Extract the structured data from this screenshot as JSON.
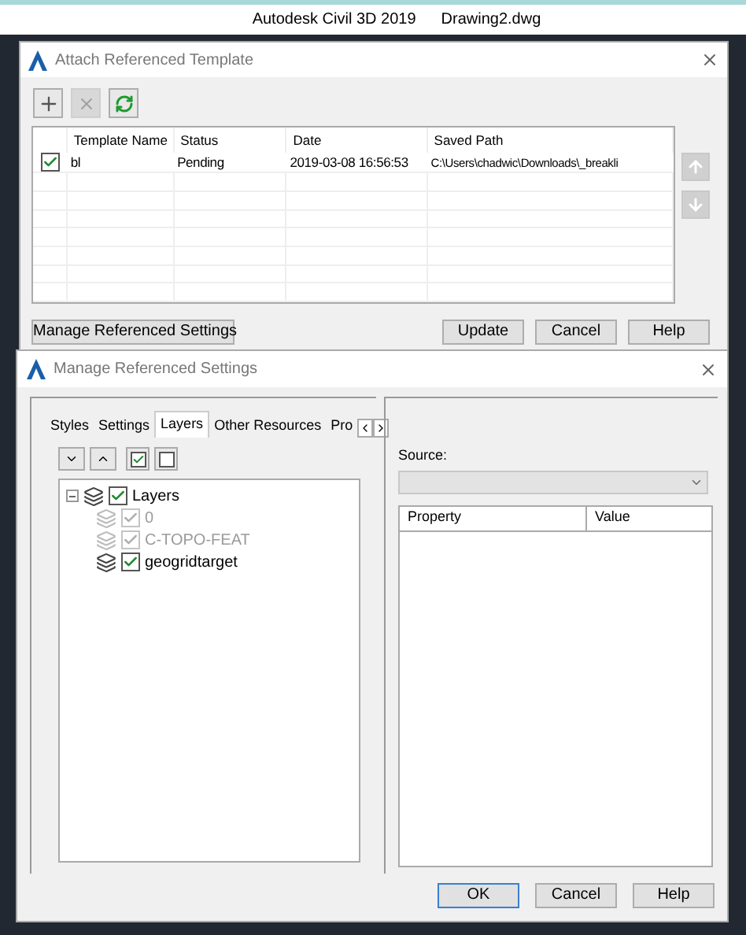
{
  "app_title": {
    "app": "Autodesk Civil 3D 2019",
    "document": "Drawing2.dwg"
  },
  "attach_dialog": {
    "title": "Attach Referenced Template",
    "toolbar": [
      {
        "kind": "add",
        "disabled": false
      },
      {
        "kind": "remove",
        "disabled": true
      },
      {
        "kind": "refresh",
        "disabled": false
      }
    ],
    "table": {
      "columns": [
        "Template Name",
        "Status",
        "Date",
        "Saved Path"
      ],
      "rows": [
        {
          "checked": true,
          "cells": [
            "bl",
            "Pending",
            "2019-03-08 16:56:53",
            "C:\\Users\\chadwic\\Downloads\\_breakli"
          ]
        }
      ]
    },
    "side_buttons": [
      {
        "kind": "up",
        "disabled": true
      },
      {
        "kind": "down",
        "disabled": true
      }
    ],
    "buttons": [
      {
        "label": "Manage Referenced Settings",
        "kind": "left"
      },
      {
        "label": "Update",
        "kind": "right"
      },
      {
        "label": "Cancel",
        "kind": "right"
      },
      {
        "label": "Help",
        "kind": "right"
      }
    ]
  },
  "settings_dialog": {
    "title": "Manage Referenced Settings",
    "tabs": [
      {
        "label": "Styles",
        "selected": false
      },
      {
        "label": "Settings",
        "selected": false
      },
      {
        "label": "Layers",
        "selected": true
      },
      {
        "label": "Other Resources",
        "selected": false
      },
      {
        "label": "Pro",
        "selected": false
      }
    ],
    "tree": [
      {
        "label": "Layers",
        "checked": true,
        "disabled": false,
        "expanded": true,
        "children": [
          {
            "label": "0",
            "checked": true,
            "disabled": true
          },
          {
            "label": "C-TOPO-FEAT",
            "checked": true,
            "disabled": true
          },
          {
            "label": "geogridtarget",
            "checked": true,
            "disabled": false
          }
        ]
      }
    ],
    "source_label": "Source:",
    "grid_columns": [
      "Property",
      "Value"
    ],
    "buttons": [
      {
        "label": "OK",
        "default": true
      },
      {
        "label": "Cancel",
        "default": false
      },
      {
        "label": "Help",
        "default": false
      }
    ]
  }
}
